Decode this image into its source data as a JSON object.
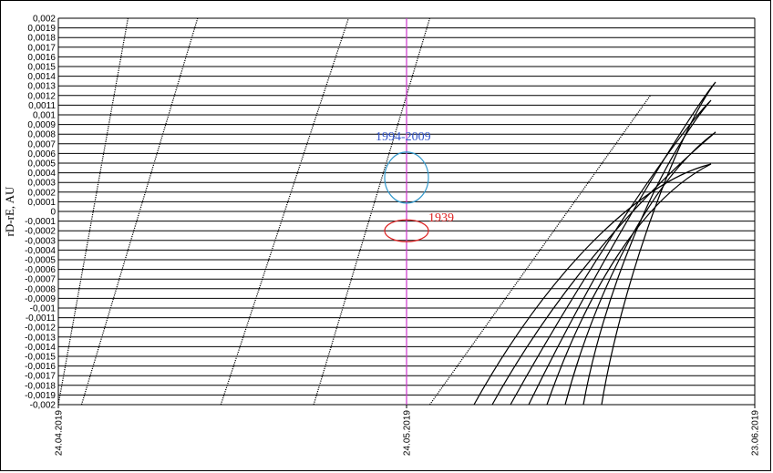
{
  "chart_data": {
    "type": "scatter",
    "ylabel": "rD-rE, AU",
    "ylim": [
      -0.002,
      0.002
    ],
    "ytick_step": 0.0001,
    "xlim": [
      "24.04.2019",
      "23.06.2019"
    ],
    "xticks": [
      "24.04.2019",
      "24.05.2019",
      "23.06.2019"
    ],
    "grid": "horizontal",
    "vertical_marker": {
      "x": "24.05.2019",
      "color": "#cc33cc"
    },
    "annotations": [
      {
        "text": "1994-2009",
        "color": "#3355cc",
        "x": "24.05.2019",
        "y": 0.00035,
        "shape": "circle",
        "shape_color": "#3399cc"
      },
      {
        "text": "1939",
        "color": "#dd2222",
        "x": "24.05.2019",
        "y": -0.0002,
        "shape": "ellipse",
        "shape_color": "#dd2222"
      }
    ],
    "series": [
      {
        "values": [
          [
            "24.04.2019",
            -0.002
          ],
          [
            "30.04.2019",
            0.002
          ]
        ]
      },
      {
        "values": [
          [
            "26.04.2019",
            -0.002
          ],
          [
            "06.05.2019",
            0.002
          ]
        ]
      },
      {
        "values": [
          [
            "08.05.2019",
            -0.002
          ],
          [
            "19.05.2019",
            0.002
          ]
        ]
      },
      {
        "values": [
          [
            "16.05.2019",
            -0.002
          ],
          [
            "26.05.2019",
            0.002
          ]
        ]
      },
      {
        "values": [
          [
            "26.05.2019",
            -0.002
          ],
          [
            "14.06.2019",
            0.0012
          ]
        ]
      }
    ]
  }
}
